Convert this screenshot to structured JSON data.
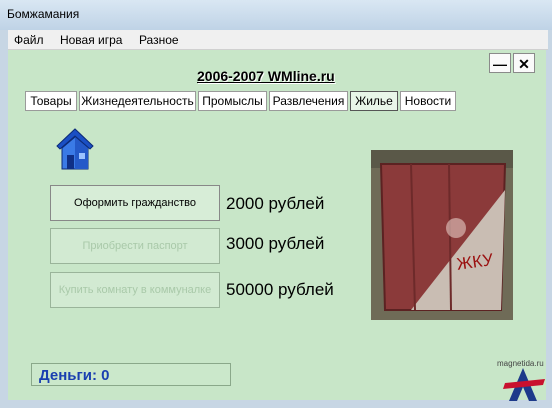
{
  "window": {
    "title": "Бомжамания"
  },
  "menu": [
    "Файл",
    "Новая игра",
    "Разное"
  ],
  "window_buttons": {
    "minimize": "—",
    "close": "✕"
  },
  "site_label": "2006-2007 WMline.ru",
  "tabs": [
    {
      "label": "Товары",
      "active": false
    },
    {
      "label": "Жизнедеятельность",
      "active": false
    },
    {
      "label": "Промыслы",
      "active": false
    },
    {
      "label": "Развлечения",
      "active": false
    },
    {
      "label": "Жилье",
      "active": true
    },
    {
      "label": "Новости",
      "active": false
    }
  ],
  "housing_options": [
    {
      "button": "Оформить гражданство",
      "price": "2000 рублей",
      "enabled": true
    },
    {
      "button": "Приобрести паспорт",
      "price": "3000 рублей",
      "enabled": false
    },
    {
      "button": "Купить комнату в коммуналке",
      "price": "50000 рублей",
      "enabled": false
    }
  ],
  "image_text": "ЖКУ",
  "money": {
    "label": "Деньги: 0"
  },
  "watermark": {
    "text": "magnetida.ru"
  },
  "icons": {
    "home": "home-icon"
  },
  "colors": {
    "background": "#c8e6c8",
    "money_text": "#1a3fb0",
    "container_red": "#8b3a3a"
  }
}
